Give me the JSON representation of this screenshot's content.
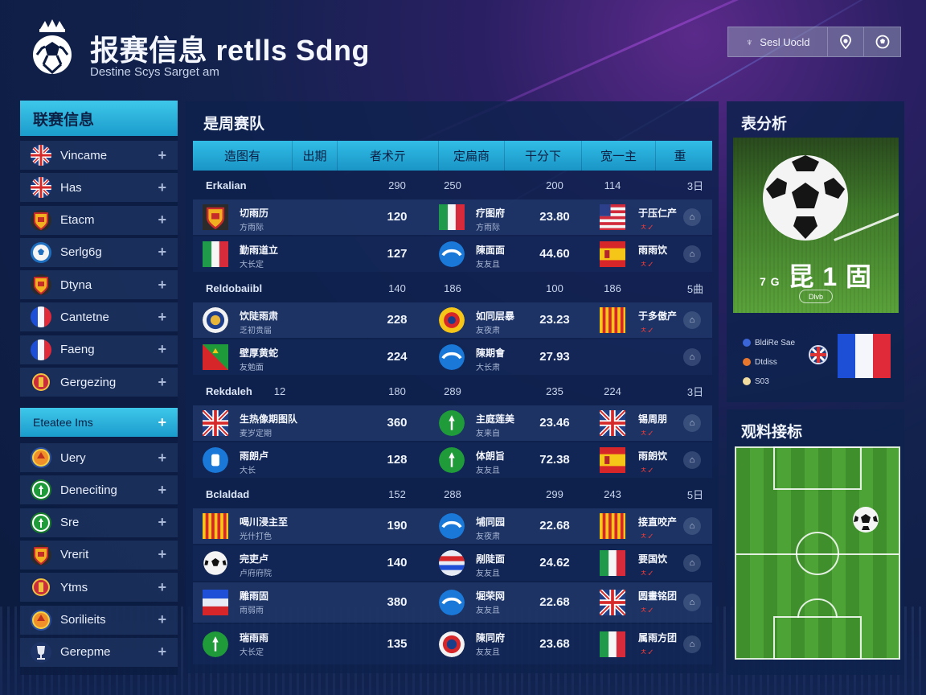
{
  "header": {
    "title": "报赛信息 retlls Sdng",
    "subtitle": "Destine Scys Sarget am",
    "toolbar": {
      "main_button": "Sesl Uocld",
      "main_icon": "trophy-icon"
    }
  },
  "sidebar": {
    "title": "联赛信息",
    "items": [
      {
        "label": "Vincame",
        "badge": "uk-flag"
      },
      {
        "label": "Has",
        "badge": "uk-flag"
      },
      {
        "label": "Etacm",
        "badge": "shield-crest"
      },
      {
        "label": "Serlg6g",
        "badge": "soccer-ball"
      },
      {
        "label": "Dtyna",
        "badge": "shield-crest"
      },
      {
        "label": "Cantetne",
        "badge": "france-flag"
      },
      {
        "label": "Faeng",
        "badge": "france-flag"
      },
      {
        "label": "Gergezing",
        "badge": "red-crest"
      }
    ],
    "highlight": {
      "label": "Eteatee Ims"
    },
    "items2": [
      {
        "label": "Uery",
        "badge": "orange-crest"
      },
      {
        "label": "Deneciting",
        "badge": "green-crest"
      },
      {
        "label": "Sre",
        "badge": "green-crest"
      },
      {
        "label": "Vrerit",
        "badge": "shield-crest"
      },
      {
        "label": "Ytms",
        "badge": "red-crest"
      },
      {
        "label": "Sorilieits",
        "badge": "orange-crest"
      },
      {
        "label": "Gerepme",
        "badge": "trophy"
      }
    ]
  },
  "main": {
    "title": "是周赛队",
    "headers": [
      "造图有",
      "出期",
      "者术亓",
      "定扁商",
      "干分下",
      "宽一主",
      "重"
    ],
    "groups": [
      {
        "name": "Erkalian",
        "n1": "",
        "n2": "290",
        "n3": "250",
        "n4": "200",
        "n5": "114",
        "n6": "3日",
        "rows": [
          {
            "name": "切雨历",
            "sub": "方雨际",
            "val1": "120",
            "val2": "23.80",
            "team2": "疗图府",
            "sub2": "方雨际",
            "team3": "于压仁产",
            "sub3": "ㅊ✓"
          },
          {
            "name": "勤雨道立",
            "sub": "大长定",
            "val1": "127",
            "val2": "44.60",
            "team2": "陳面面",
            "sub2": "友友且",
            "team3": "雨雨饮",
            "sub3": "ㅊ✓"
          }
        ]
      },
      {
        "name": "Reldobaiibl",
        "n1": "",
        "n2": "140",
        "n3": "186",
        "n4": "100",
        "n5": "186",
        "n6": "5曲",
        "rows": [
          {
            "name": "饮陡雨肃",
            "sub": "乏初贵届",
            "val1": "228",
            "val2": "23.23",
            "team2": "如同层暴",
            "sub2": "友夜肃",
            "team3": "于多傲产",
            "sub3": "ㅊ✓"
          },
          {
            "name": "壁厚黄蛇",
            "sub": "友勉面",
            "val1": "224",
            "val2": "27.93",
            "team2": "陳期會",
            "sub2": "大长肃",
            "team3": "",
            "sub3": ""
          }
        ]
      },
      {
        "name": "Rekdaleh",
        "n1": "12",
        "n2": "180",
        "n3": "289",
        "n4": "235",
        "n5": "224",
        "n6": "3日",
        "rows": [
          {
            "name": "生热像期图队",
            "sub": "麦岁定期",
            "val1": "360",
            "val2": "23.46",
            "team2": "主庭莲美",
            "sub2": "友来自",
            "team3": "锡周朋",
            "sub3": "ㅊ✓"
          },
          {
            "name": "雨朗卢",
            "sub": "大长",
            "val1": "128",
            "val2": "72.38",
            "team2": "体朗旨",
            "sub2": "友友且",
            "team3": "雨朗饮",
            "sub3": "ㅊ✓"
          }
        ]
      },
      {
        "name": "Bclaldad",
        "n1": "",
        "n2": "152",
        "n3": "288",
        "n4": "299",
        "n5": "243",
        "n6": "5日",
        "rows": [
          {
            "name": "喝川浸主至",
            "sub": "光什打色",
            "val1": "190",
            "val2": "22.68",
            "team2": "埔同园",
            "sub2": "友夜肃",
            "team3": "接直咬产",
            "sub3": "ㅊ✓"
          },
          {
            "name": "完吏卢",
            "sub": "卢府府院",
            "val1": "140",
            "val2": "24.62",
            "team2": "剐陡面",
            "sub2": "友友且",
            "team3": "要国饮",
            "sub3": "ㅊ✓"
          },
          {
            "name": "雕雨固",
            "sub": "雨弱雨",
            "val1": "380",
            "val2": "22.68",
            "team2": "堀荣网",
            "sub2": "友友且",
            "team3": "圆畫铭团",
            "sub3": "ㅊ✓"
          },
          {
            "name": "瑞雨雨",
            "sub": "大长定",
            "val1": "135",
            "val2": "23.68",
            "team2": "陳同府",
            "sub2": "友友且",
            "team3": "属雨方团",
            "sub3": "ㅊ✓"
          }
        ]
      }
    ]
  },
  "analysis": {
    "title": "表分析",
    "score": "昆 1 固",
    "score_prefix": "7 G",
    "pill": "Dlvb",
    "legend": [
      {
        "label": "BldiRe Sae",
        "color": "#3a66d8"
      },
      {
        "label": "Dtdiss",
        "color": "#e8772e"
      },
      {
        "label": "S03",
        "color": "#f2dca0"
      }
    ]
  },
  "tactics": {
    "title": "观料接标"
  },
  "colors": {
    "accent": "#2fb7e4",
    "panel": "#0e224e",
    "highlight_text": "#0c2146"
  }
}
